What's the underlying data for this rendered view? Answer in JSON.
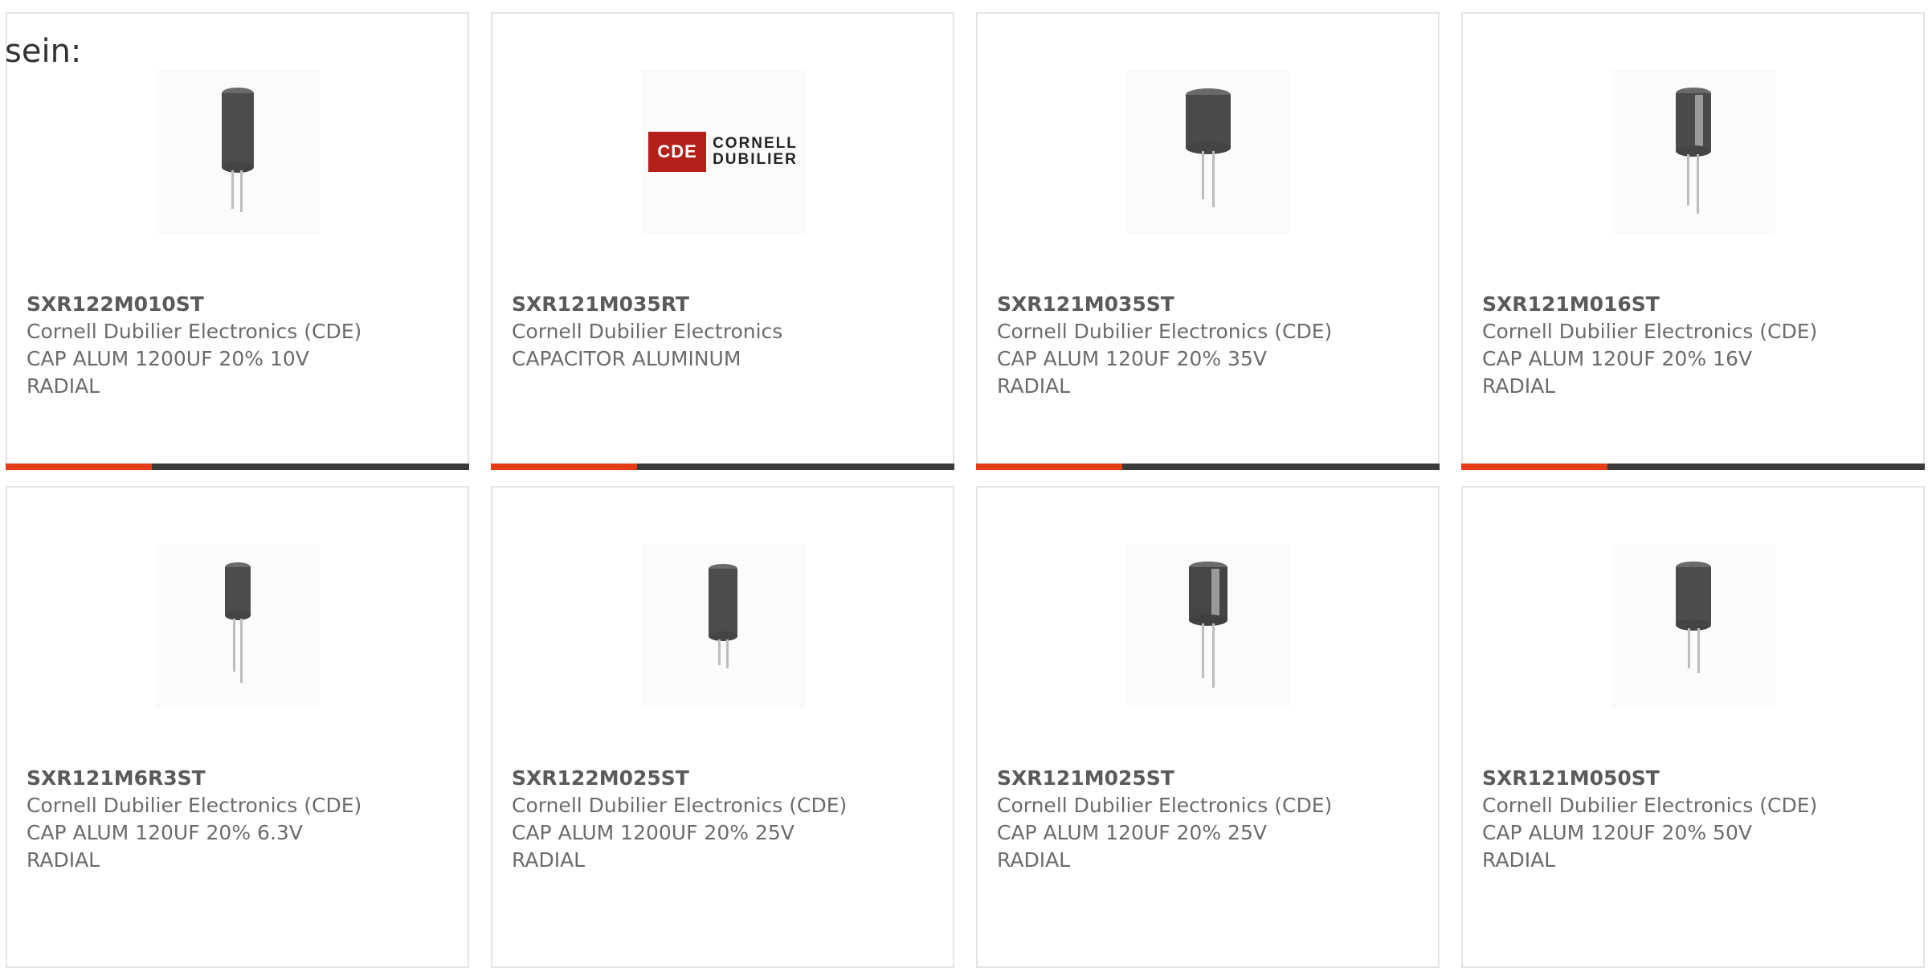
{
  "lead_text": "sein:",
  "accent_color": "#e63b16",
  "products": [
    {
      "part": "SXR122M010ST",
      "maker": "Cornell Dubilier Electronics (CDE)",
      "desc": "CAP ALUM 1200UF 20% 10V\nRADIAL",
      "image": "capacitor-icon"
    },
    {
      "part": "SXR121M035RT",
      "maker": "Cornell Dubilier Electronics",
      "desc": "CAPACITOR ALUMINUM",
      "image": "cde-logo",
      "logo": {
        "mark": "CDE",
        "name_line1": "CORNELL",
        "name_line2": "DUBILIER"
      }
    },
    {
      "part": "SXR121M035ST",
      "maker": "Cornell Dubilier Electronics (CDE)",
      "desc": "CAP ALUM 120UF 20% 35V\nRADIAL",
      "image": "capacitor-icon"
    },
    {
      "part": "SXR121M016ST",
      "maker": "Cornell Dubilier Electronics (CDE)",
      "desc": "CAP ALUM 120UF 20% 16V\nRADIAL",
      "image": "capacitor-icon"
    },
    {
      "part": "SXR121M6R3ST",
      "maker": "Cornell Dubilier Electronics (CDE)",
      "desc": "CAP ALUM 120UF 20% 6.3V\nRADIAL",
      "image": "capacitor-icon"
    },
    {
      "part": "SXR122M025ST",
      "maker": "Cornell Dubilier Electronics (CDE)",
      "desc": "CAP ALUM 1200UF 20% 25V\nRADIAL",
      "image": "capacitor-icon"
    },
    {
      "part": "SXR121M025ST",
      "maker": "Cornell Dubilier Electronics (CDE)",
      "desc": "CAP ALUM 120UF 20% 25V\nRADIAL",
      "image": "capacitor-icon"
    },
    {
      "part": "SXR121M050ST",
      "maker": "Cornell Dubilier Electronics (CDE)",
      "desc": "CAP ALUM 120UF 20% 50V\nRADIAL",
      "image": "capacitor-icon"
    }
  ]
}
